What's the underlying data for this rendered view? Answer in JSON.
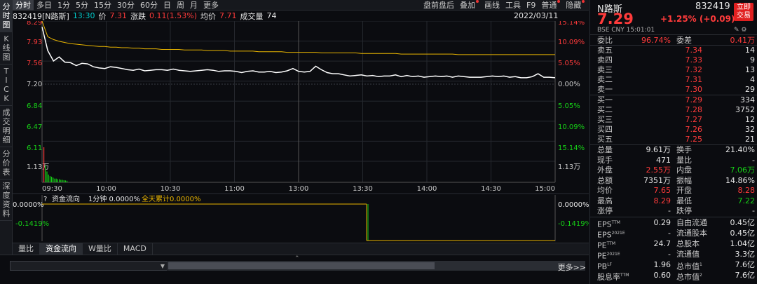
{
  "leftnav": [
    "分时图",
    "K线图",
    "TICK",
    "成交明细",
    "分价表",
    "深度资料"
  ],
  "toolbar": {
    "periods": [
      "分时",
      "多日",
      "1分",
      "5分",
      "15分",
      "30分",
      "60分",
      "日",
      "周",
      "月",
      "更多"
    ],
    "active": "分时",
    "right_items": [
      "盘前盘后",
      "叠加",
      "画线",
      "工具",
      "F9",
      "普通",
      "隐藏"
    ]
  },
  "infoline": {
    "code": "832419[N路斯]",
    "time": "13:30",
    "price_label": "价",
    "price": "7.31",
    "change_label": "涨跌",
    "change": "0.11(1.53%)",
    "avg_label": "均价",
    "avg": "7.71",
    "vol_label": "成交量",
    "vol": "74",
    "date": "2022/03/11"
  },
  "chart_data": {
    "type": "line",
    "x_ticks": [
      "09:30",
      "10:00",
      "10:30",
      "11:00",
      "13:00",
      "13:30",
      "14:00",
      "14:30",
      "15:00"
    ],
    "y_left_ticks": [
      "8.29",
      "7.93",
      "7.56",
      "7.20",
      "6.84",
      "6.47",
      "6.11",
      "1.13万"
    ],
    "y_right_ticks": [
      "15.14%",
      "10.09%",
      "5.05%",
      "0.00%",
      "5.05%",
      "10.09%",
      "15.14%",
      "1.13万"
    ],
    "ylim": [
      6.11,
      8.29
    ],
    "prev_close": 7.2,
    "series": [
      {
        "values": [
          8.19,
          7.78,
          7.6,
          7.67,
          7.58,
          7.57,
          7.52,
          7.56,
          7.55,
          7.5,
          7.48,
          7.47,
          7.5,
          7.49,
          7.47,
          7.45,
          7.44,
          7.46,
          7.43,
          7.44,
          7.45,
          7.45,
          7.44,
          7.46,
          7.44,
          7.43,
          7.42,
          7.43,
          7.44,
          7.45,
          7.44,
          7.42,
          7.43,
          7.43,
          7.42,
          7.4,
          7.42,
          7.43,
          7.41,
          7.41,
          7.42,
          7.4,
          7.41,
          7.43,
          7.47,
          7.42,
          7.41,
          7.42,
          7.51,
          7.45,
          7.4,
          7.38,
          7.38,
          7.36,
          7.34,
          7.35,
          7.36,
          7.34,
          7.35,
          7.33,
          7.34,
          7.34,
          7.36,
          7.33,
          7.35,
          7.33,
          7.34,
          7.32,
          7.33,
          7.34,
          7.33,
          7.34,
          7.32,
          7.34,
          7.33,
          7.32,
          7.32,
          7.32,
          7.33,
          7.34,
          7.33,
          7.34,
          7.32,
          7.33,
          7.31,
          7.31,
          7.33,
          7.38,
          7.32,
          7.32,
          7.31
        ]
      },
      {
        "values": [
          8.29,
          8.02,
          7.97,
          7.94,
          7.92,
          7.9,
          7.89,
          7.88,
          7.87,
          7.86,
          7.85,
          7.85,
          7.84,
          7.84,
          7.83,
          7.83,
          7.82,
          7.82,
          7.81,
          7.81,
          7.81,
          7.8,
          7.8,
          7.8,
          7.8,
          7.79,
          7.79,
          7.79,
          7.79,
          7.78,
          7.78,
          7.78,
          7.78,
          7.77,
          7.77,
          7.77,
          7.77,
          7.77,
          7.76,
          7.76,
          7.76,
          7.76,
          7.76,
          7.75,
          7.75,
          7.75,
          7.75,
          7.75,
          7.75,
          7.74,
          7.74,
          7.74,
          7.74,
          7.74,
          7.74,
          7.74,
          7.73,
          7.73,
          7.73,
          7.73,
          7.73,
          7.73,
          7.73,
          7.72,
          7.72,
          7.72,
          7.72,
          7.72,
          7.72,
          7.72,
          7.72,
          7.72,
          7.72,
          7.71,
          7.71,
          7.71,
          7.71,
          7.71,
          7.71,
          7.71,
          7.71,
          7.71,
          7.71,
          7.71,
          7.71,
          7.71,
          7.71,
          7.71,
          7.71,
          7.71,
          7.71
        ]
      }
    ],
    "volume": [
      1.13,
      0.55,
      0.35,
      0.25,
      0.2,
      0.18,
      0.15,
      0.12,
      0.12,
      0.1,
      0.1,
      0.08,
      0.08,
      0.07,
      0.06,
      0.05
    ],
    "sub": {
      "title": "资金流向",
      "params": "1分钟 0.0000%",
      "cum_label": "全天累计",
      "cum_value": "0.0000%",
      "y_ticks": [
        "0.0000%",
        "-0.1419%"
      ]
    }
  },
  "bottom_tabs": [
    "量比",
    "资金流向",
    "W量比",
    "MACD"
  ],
  "active_tab": "资金流向",
  "status": {
    "more": "更多>>"
  },
  "right": {
    "name": "N路斯",
    "code": "832419",
    "price": "7.29",
    "change": "+1.25% (+0.09)",
    "meta": "BSE  CNY  15:01:01",
    "buy_button": "立即交易",
    "weibi_label": "委比",
    "weibi": "96.74%",
    "weicha_label": "委差",
    "weicha": "0.41万",
    "asks": [
      {
        "label": "卖五",
        "price": "7.34",
        "vol": "14"
      },
      {
        "label": "卖四",
        "price": "7.33",
        "vol": "9"
      },
      {
        "label": "卖三",
        "price": "7.32",
        "vol": "13"
      },
      {
        "label": "卖二",
        "price": "7.31",
        "vol": "4"
      },
      {
        "label": "卖一",
        "price": "7.30",
        "vol": "29"
      }
    ],
    "bids": [
      {
        "label": "买一",
        "price": "7.29",
        "vol": "334"
      },
      {
        "label": "买二",
        "price": "7.28",
        "vol": "3752"
      },
      {
        "label": "买三",
        "price": "7.27",
        "vol": "12"
      },
      {
        "label": "买四",
        "price": "7.26",
        "vol": "32"
      },
      {
        "label": "买五",
        "price": "7.25",
        "vol": "21"
      }
    ],
    "stats": [
      {
        "l1": "总量",
        "v1": "9.61万",
        "l2": "换手",
        "v2": "21.40%"
      },
      {
        "l1": "现手",
        "v1": "471",
        "l2": "量比",
        "v2": "-"
      },
      {
        "l1": "外盘",
        "v1": "2.55万",
        "l2": "内盘",
        "v2": "7.06万"
      },
      {
        "l1": "总额",
        "v1": "7351万",
        "l2": "振幅",
        "v2": "14.86%"
      },
      {
        "l1": "均价",
        "v1": "7.65",
        "l2": "开盘",
        "v2": "8.28"
      },
      {
        "l1": "最高",
        "v1": "8.29",
        "l2": "最低",
        "v2": "7.22"
      },
      {
        "l1": "涨停",
        "v1": "-",
        "l2": "跌停",
        "v2": "-"
      }
    ],
    "fin": [
      {
        "l1": "EPS",
        "sup1": "TTM",
        "v1": "0.29",
        "l2": "自由流通",
        "v2": "0.45亿"
      },
      {
        "l1": "EPS",
        "sup1": "2021E",
        "v1": "-",
        "l2": "流通股本",
        "v2": "0.45亿"
      },
      {
        "l1": "PE",
        "sup1": "TTM",
        "v1": "24.7",
        "l2": "总股本",
        "v2": "1.04亿"
      },
      {
        "l1": "PE",
        "sup1": "2021E",
        "v1": "-",
        "l2": "流通值",
        "v2": "3.3亿"
      },
      {
        "l1": "PB",
        "sup1": "LF",
        "v1": "1.96",
        "l2": "总市值",
        "sup2": "1",
        "v2": "7.6亿"
      },
      {
        "l1": "股息率",
        "sup1": "TTM",
        "v1": "0.60",
        "l2": "总市值",
        "sup2": "2",
        "v2": "7.6亿"
      }
    ],
    "colors": {
      "up": "#ff3b3b",
      "down": "#16d016",
      "price_line": "#ffffff",
      "avg_line": "#e8b400"
    }
  }
}
